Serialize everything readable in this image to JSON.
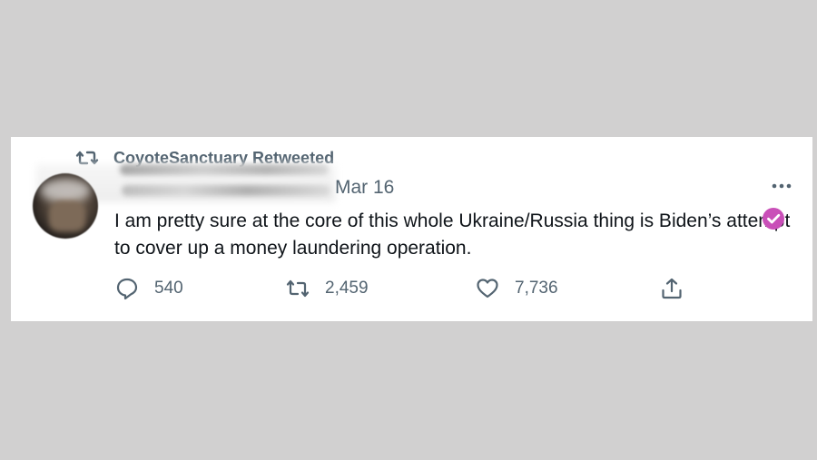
{
  "retweet_banner": {
    "text": "CoyoteSanctuary Retweeted",
    "icon": "retweet-icon"
  },
  "tweet": {
    "date": "Mar 16",
    "text": "I am pretty sure at the core of this whole Ukraine/Russia thing is Biden’s attempt to cover up a money laundering operation.",
    "more_icon": "more-icon",
    "badge_icon": "verified-check-icon"
  },
  "actions": {
    "reply": {
      "icon": "reply-icon",
      "count": "540"
    },
    "retweet": {
      "icon": "retweet-icon",
      "count": "2,459"
    },
    "like": {
      "icon": "heart-icon",
      "count": "7,736"
    },
    "share": {
      "icon": "share-icon"
    }
  },
  "colors": {
    "background": "#d1d0d0",
    "card": "#ffffff",
    "text": "#0f1419",
    "muted": "#536471",
    "badge": "#c94fb8"
  }
}
